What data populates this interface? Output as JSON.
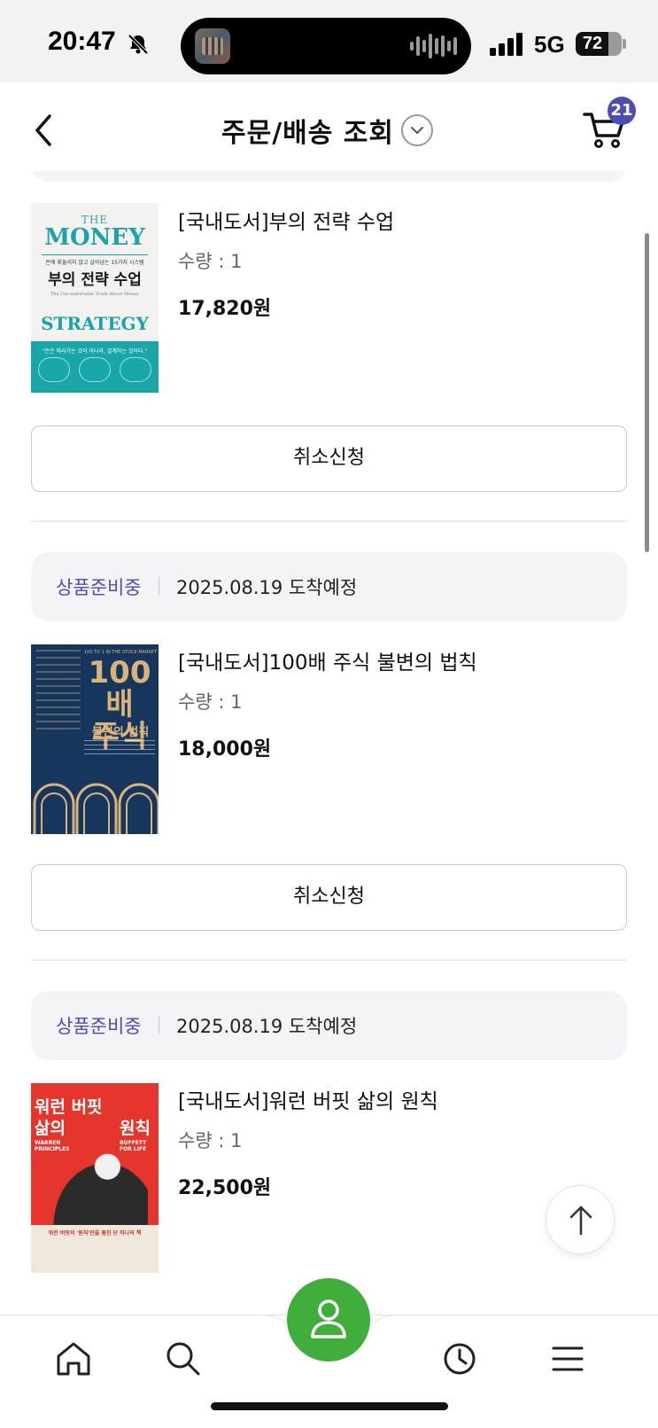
{
  "status_bar": {
    "time": "20:47",
    "network": "5G",
    "battery": "72",
    "battery_level": 0.72,
    "icons": [
      "bell-off-icon",
      "signal-icon",
      "battery-icon"
    ]
  },
  "header": {
    "title": "주문/배송 조회",
    "cart_count": "21",
    "icons": [
      "back-icon",
      "chevron-down-icon",
      "cart-icon"
    ]
  },
  "orders": [
    {
      "book": {
        "title": "[국내도서]부의 전략 수업",
        "quantity": "수량 : 1",
        "price": "17,820원",
        "cover": {
          "the": "THE",
          "money": "MONEY",
          "subtitle": "돈에 휘둘리지 않고 살아남는 15가지 시스템",
          "korean_title": "부의 전략 수업",
          "english_line": "The Uncomfortable Truth About Money",
          "strategy": "STRATEGY",
          "quote": "\"돈은 따라가는 것이 아니라, 설계하는 것이다.\""
        }
      },
      "cancel_label": "취소신청"
    },
    {
      "status": "상품준비중",
      "arrival": "2025.08.19 도착예정",
      "book": {
        "title": "[국내도서]100배 주식 불변의 법칙",
        "quantity": "수량 : 1",
        "price": "18,000원",
        "cover": {
          "top": "100 TO 1 IN THE STOCK MARKET",
          "big": "100배\n주식",
          "rule": "불변의 법칙"
        }
      },
      "cancel_label": "취소신청"
    },
    {
      "status": "상품준비중",
      "arrival": "2025.08.19 도착예정",
      "book": {
        "title": "[국내도서]워런 버핏 삶의 원칙",
        "quantity": "수량 : 1",
        "price": "22,500원",
        "cover": {
          "t1": "워런 버핏",
          "t2": "삶의",
          "t3": "원칙",
          "en1": "WARREN\nPRINCIPLES",
          "en2": "BUFFETT\nFOR LIFE",
          "bottom": "워런 버핏의 '원칙'만을 훔친 단 하나의 책"
        }
      }
    }
  ],
  "floating": {
    "icon": "arrow-up-icon"
  },
  "bottom_nav": {
    "items": [
      "home-icon",
      "search-icon",
      "profile-icon",
      "history-icon",
      "menu-icon"
    ],
    "accent": "#3fae3a"
  },
  "colors": {
    "brand": "#4b4db4",
    "status_strip": "#f3f3f8",
    "nav_green": "#3fae3a"
  }
}
